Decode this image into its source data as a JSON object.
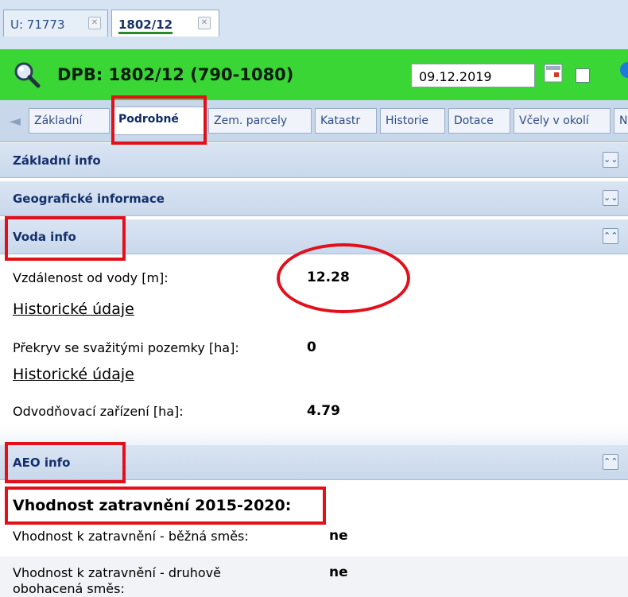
{
  "doc_tabs": [
    {
      "label": "U: 71773",
      "close": "✕"
    },
    {
      "label": "1802/12",
      "close": "✕"
    }
  ],
  "header": {
    "title": "DPB: 1802/12 (790-1080)",
    "date": "09.12.2019"
  },
  "sub_tabs": [
    "Základní",
    "Podrobné",
    "Zem. parcely",
    "Katastr",
    "Historie",
    "Dotace",
    "Včely v okolí",
    "N"
  ],
  "sections": {
    "zakladni": {
      "title": "Základní info",
      "toggle": "⌄⌄"
    },
    "geo": {
      "title": "Geografické informace",
      "toggle": "⌄⌄"
    },
    "voda": {
      "title": "Voda info",
      "toggle": "⌃⌃"
    },
    "aeo": {
      "title": "AEO info",
      "toggle": "⌃⌃"
    }
  },
  "voda_rows": {
    "distance_label": "Vzdálenost od vody [m]:",
    "distance_value": "12.28",
    "hist1": "Historické údaje",
    "overlap_label": "Překryv se svažitými pozemky [ha]:",
    "overlap_value": "0",
    "hist2": "Historické údaje",
    "drainage_label": "Odvodňovací zařízení [ha]:",
    "drainage_value": "4.79"
  },
  "aeo_rows": {
    "heading": "Vhodnost zatravnění 2015-2020:",
    "row1_label": "Vhodnost k zatravnění - běžná směs:",
    "row1_value": "ne",
    "row2_label_line1": "Vhodnost k zatravnění - druhově",
    "row2_label_line2": "obohacená směs:",
    "row2_value": "ne"
  },
  "icons": [
    "search-icon",
    "calendar-icon",
    "close-icon",
    "arrow-left-icon",
    "expand-icon",
    "collapse-icon"
  ],
  "colors": {
    "header_green": "#3ad636",
    "annotation_red": "#e2101a",
    "panel_blue": "#c9d8ec"
  }
}
